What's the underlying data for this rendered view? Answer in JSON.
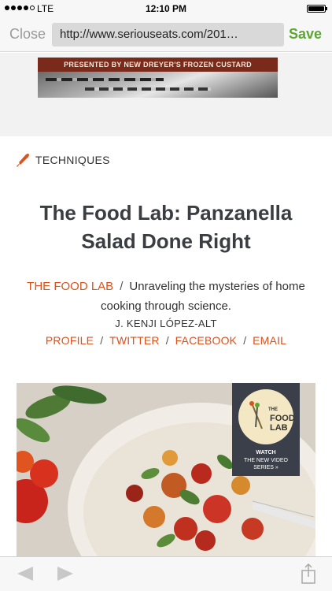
{
  "status_bar": {
    "carrier": "LTE",
    "time": "12:10 PM",
    "battery_level": 1.0
  },
  "nav": {
    "close_label": "Close",
    "url": "http://www.seriouseats.com/201…",
    "save_label": "Save"
  },
  "ad": {
    "banner_text": "PRESENTED BY NEW DREYER'S FROZEN CUSTARD"
  },
  "article": {
    "section": "TECHNIQUES",
    "title": "The Food Lab: Panzanella Salad Done Right",
    "column_name": "THE FOOD LAB",
    "column_tagline": "Unraveling the mysteries of home cooking through science.",
    "author": "J. KENJI LÓPEZ-ALT",
    "author_links": [
      "PROFILE",
      "TWITTER",
      "FACEBOOK",
      "EMAIL"
    ],
    "badge": {
      "the": "THE",
      "food": "FOOD",
      "lab": "LAB",
      "watch": "WATCH",
      "sub1": "THE NEW VIDEO",
      "sub2": "SERIES »"
    }
  },
  "colors": {
    "accent": "#d9531e",
    "save": "#5ca632",
    "title": "#3a3d42"
  },
  "icons": {
    "section": "knife-icon",
    "back": "back-arrow-icon",
    "forward": "forward-arrow-icon",
    "share": "share-icon"
  }
}
